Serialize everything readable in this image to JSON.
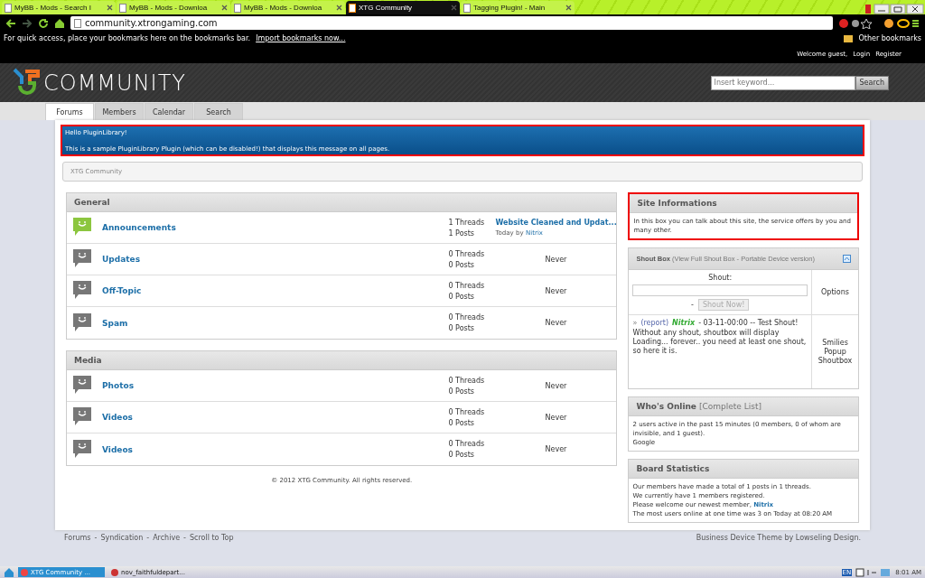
{
  "browser": {
    "tabs": [
      {
        "title": "MyBB - Mods - Search I",
        "selected": false
      },
      {
        "title": "MyBB - Mods - Downloa",
        "selected": false
      },
      {
        "title": "MyBB - Mods - Downloa",
        "selected": false
      },
      {
        "title": "XTG Community",
        "selected": true
      },
      {
        "title": "Tagging Plugin! - Main",
        "selected": false
      }
    ],
    "address": "community.xtrongaming.com",
    "bookmarks_bar": {
      "message": "For quick access, place your bookmarks here on the bookmarks bar.",
      "link": "Import bookmarks now...",
      "other": "Other bookmarks"
    }
  },
  "page": {
    "userbar": {
      "welcome": "Welcome guest,",
      "links": [
        "Login",
        "Register"
      ]
    },
    "logo": "COMMUNITY",
    "search": {
      "placeholder": "Insert keyword...",
      "button": "Search"
    },
    "nav": [
      {
        "label": "Forums",
        "selected": true
      },
      {
        "label": "Members",
        "selected": false
      },
      {
        "label": "Calendar",
        "selected": false
      },
      {
        "label": "Search",
        "selected": false
      }
    ],
    "notice": {
      "title": "Hello PluginLibrary!",
      "message": "This is a sample PluginLibrary Plugin (which can be disabled!) that displays this message on all pages."
    },
    "breadcrumb": "XTG Community",
    "categories": [
      {
        "name": "General",
        "forums": [
          {
            "name": "Announcements",
            "unread": true,
            "threads": "1 Threads",
            "posts": "1 Posts",
            "last_post": {
              "title": "Website Cleaned and Updat...",
              "time": "Today by",
              "author": "Nitrix"
            }
          },
          {
            "name": "Updates",
            "unread": false,
            "threads": "0 Threads",
            "posts": "0 Posts",
            "last_post": {
              "never": "Never"
            }
          },
          {
            "name": "Off-Topic",
            "unread": false,
            "threads": "0 Threads",
            "posts": "0 Posts",
            "last_post": {
              "never": "Never"
            }
          },
          {
            "name": "Spam",
            "unread": false,
            "threads": "0 Threads",
            "posts": "0 Posts",
            "last_post": {
              "never": "Never"
            }
          }
        ]
      },
      {
        "name": "Media",
        "forums": [
          {
            "name": "Photos",
            "unread": false,
            "threads": "0 Threads",
            "posts": "0 Posts",
            "last_post": {
              "never": "Never"
            }
          },
          {
            "name": "Videos",
            "unread": false,
            "threads": "0 Threads",
            "posts": "0 Posts",
            "last_post": {
              "never": "Never"
            }
          },
          {
            "name": "Videos",
            "unread": false,
            "threads": "0 Threads",
            "posts": "0 Posts",
            "last_post": {
              "never": "Never"
            }
          }
        ]
      }
    ],
    "copyright": "© 2012 XTG Community. All rights reserved.",
    "site_info": {
      "title": "Site Informations",
      "text": "In this box you can talk about this site, the service offers by you and many other."
    },
    "shoutbox": {
      "title": "Shout Box",
      "subtitle": "(View Full Shout Box - Portable Device version)",
      "label": "Shout:",
      "options": "Options",
      "dash": "-",
      "button": "Shout Now!",
      "entry": {
        "marker": "»",
        "report": "(report)",
        "author": "Nitrix",
        "meta": "- 03-11-00:00 -- Test Shout!",
        "text": "Without any shout, shoutbox will display Loading... forever.. you need at least one shout, so here it is."
      },
      "side_links": [
        "Smilies",
        "Popup",
        "Shoutbox"
      ]
    },
    "whos_online": {
      "title": "Who's Online",
      "link": "[Complete List]",
      "text": "2 users active in the past 15 minutes (0 members, 0 of whom are invisible, and 1 guest).",
      "bot": "Google"
    },
    "board_stats": {
      "title": "Board Statistics",
      "lines": [
        "Our members have made a total of 1 posts in 1 threads.",
        "We currently have 1 members registered."
      ],
      "welcome": "Please welcome our newest member,",
      "member": "Nitrix",
      "record": "The most users online at one time was 3 on Today at 08:20 AM"
    },
    "footer_links": [
      "Forums",
      "Syndication",
      "Archive",
      "Scroll to Top"
    ],
    "footer_sep": "-",
    "credit": "Business Device Theme by Lowseling Design."
  },
  "taskbar": {
    "items": [
      {
        "label": "XTG Community ...",
        "selected": true
      },
      {
        "label": "nov_faithfuldepart...",
        "selected": false
      }
    ],
    "tray_lang": "EN",
    "time": "8:01 AM"
  }
}
